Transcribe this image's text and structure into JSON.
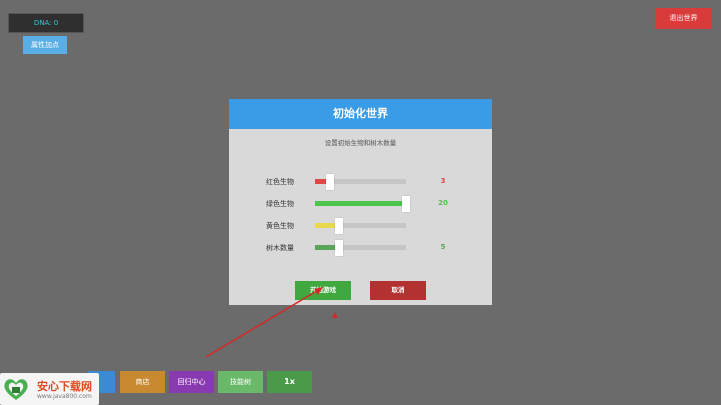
{
  "hud": {
    "dna_label": "DNA: 0",
    "attribute_button": "属性加点",
    "exit_button": "退出世界"
  },
  "dialog": {
    "title": "初始化世界",
    "subtitle": "设置初始生物和树木数量",
    "rows": [
      {
        "label": "红色生物",
        "value": "3",
        "fraction": 0.15,
        "color": "#e04848"
      },
      {
        "label": "绿色生物",
        "value": "20",
        "fraction": 0.99,
        "color": "#4dc44d"
      },
      {
        "label": "黄色生物",
        "value": "",
        "fraction": 0.25,
        "color": "#e8d84a"
      },
      {
        "label": "树木数量",
        "value": "5",
        "fraction": 0.25,
        "color": "#5aa55a"
      }
    ],
    "start_button": "开始游戏",
    "cancel_button": "取消"
  },
  "bottombar": {
    "shop": "商店",
    "recycle": "回归中心",
    "skill": "技能树",
    "speed": "1x"
  },
  "watermark": {
    "title": "安心下载网",
    "url": "www.java800.com"
  },
  "colors": {
    "header": "#3a9be6",
    "start": "#3fa83f",
    "cancel": "#b33131",
    "shop": "#c88a30",
    "recycle": "#8a3ab0",
    "skill": "#6ab86a",
    "speed": "#4a9a4a",
    "annotation_arrow": "#d62828"
  }
}
